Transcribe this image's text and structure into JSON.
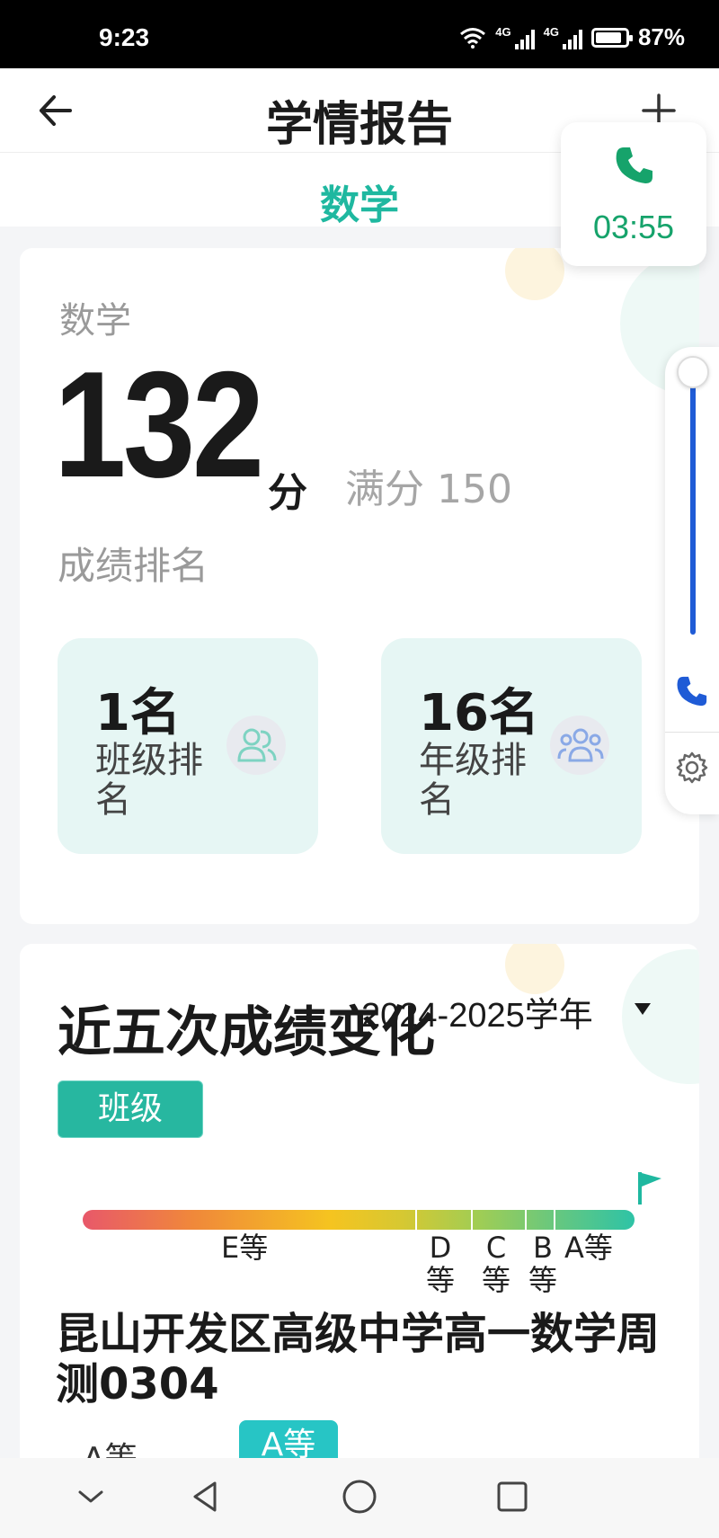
{
  "status_bar": {
    "time": "9:23",
    "net1": "4G",
    "net2": "4G",
    "battery": "87%"
  },
  "header": {
    "title": "学情报告"
  },
  "subject_tab": "数学",
  "call": {
    "timer": "03:55"
  },
  "score_card": {
    "subject": "数学",
    "score": "132",
    "unit": "分",
    "full_score": "满分 150",
    "rank_title": "成绩排名",
    "class_rank": {
      "value": "1名",
      "label": "班级排名"
    },
    "grade_rank": {
      "value": "16名",
      "label": "年级排名"
    }
  },
  "trend_card": {
    "title": "近五次成绩变化",
    "school_year": "2024-2025学年",
    "scope_tab": "班级",
    "grade_labels": {
      "e": "E等",
      "d": "D等",
      "c": "C等",
      "b": "B等",
      "a": "A等"
    },
    "exam_name": "昆山开发区高级中学高一数学周测0304",
    "row_label": "A等",
    "row_badge": "A等"
  },
  "colors": {
    "accent": "#1fb8a0",
    "call_green": "#16a36b",
    "volume_blue": "#1f5bd6"
  },
  "icons": [
    "back-arrow-icon",
    "plus-icon",
    "phone-icon",
    "settings-gear-icon",
    "group-icon",
    "flag-icon",
    "chevron-down-icon",
    "triangle-back-icon",
    "circle-home-icon",
    "square-recent-icon"
  ]
}
